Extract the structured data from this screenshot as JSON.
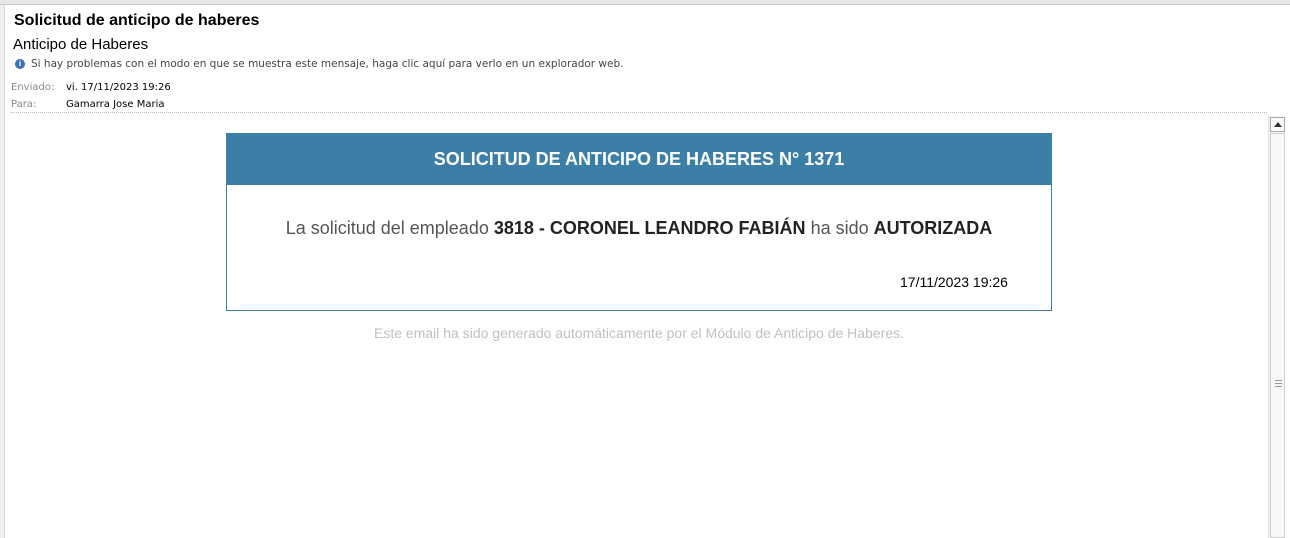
{
  "email": {
    "subject": "Solicitud de anticipo de haberes",
    "thread_title": "Anticipo de Haberes",
    "info_bar": "Si hay problemas con el modo en que se muestra este mensaje, haga clic aquí para verlo en un explorador web.",
    "sent_label": "Enviado:",
    "sent_value": "vi. 17/11/2023 19:26",
    "to_label": "Para:",
    "to_value": "Gamarra Jose Maria"
  },
  "card": {
    "header": "SOLICITUD DE ANTICIPO DE HABERES N° 1371",
    "message_prefix": "La solicitud del empleado ",
    "employee": "3818 - CORONEL LEANDRO FABIÁN",
    "message_middle": " ha sido ",
    "status": "AUTORIZADA",
    "date": "17/11/2023 19:26"
  },
  "footer": "Este email ha sido generado automáticamente por el Módulo de Anticipo de Haberes.",
  "icons": {
    "info": "info-icon",
    "scroll_up": "arrow-up-icon",
    "grip": "scroll-grip-icon"
  },
  "colors": {
    "accent": "#3b7fa6",
    "footer_text": "#c0c0c0"
  }
}
